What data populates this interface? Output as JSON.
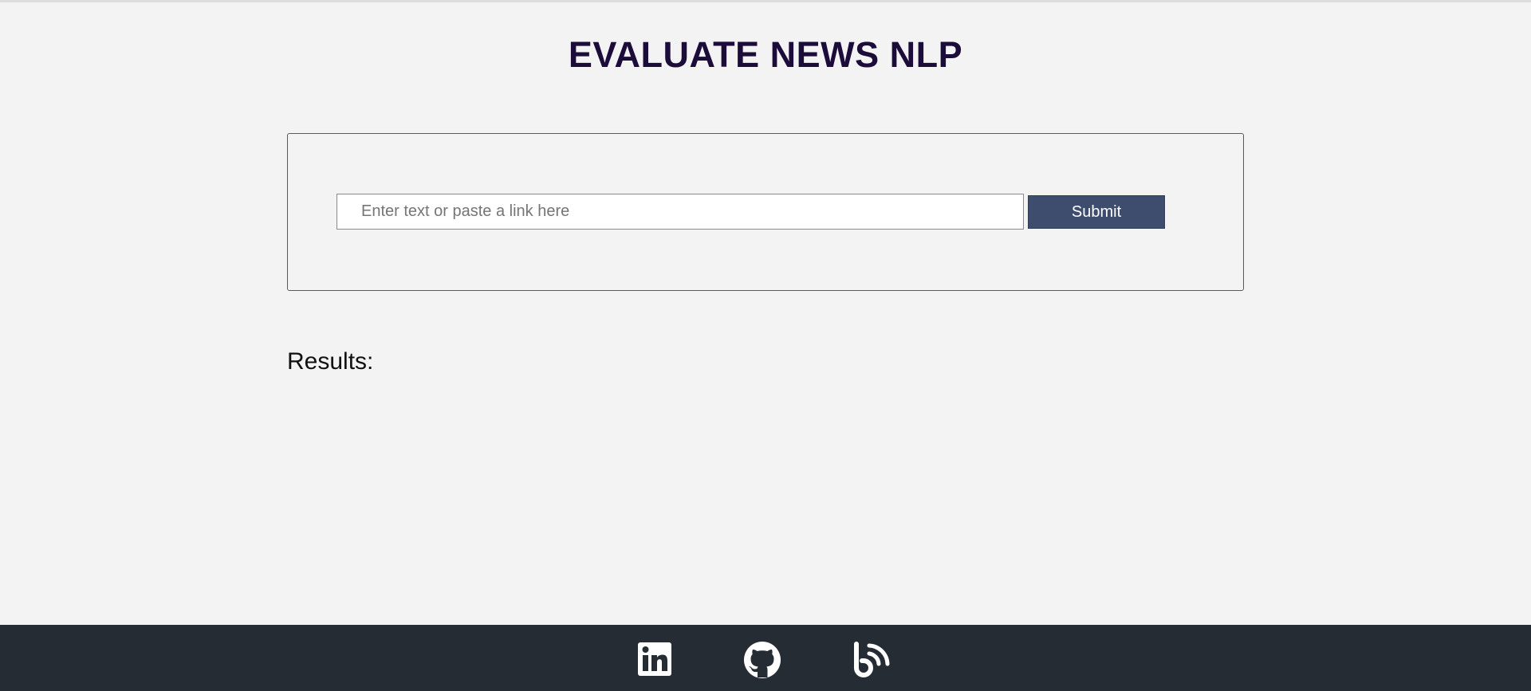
{
  "header": {
    "title": "EVALUATE NEWS NLP"
  },
  "form": {
    "input_placeholder": "Enter text or paste a link here",
    "input_value": "",
    "submit_label": "Submit"
  },
  "results": {
    "heading": "Results:"
  },
  "footer": {
    "links": [
      {
        "icon": "linkedin-icon"
      },
      {
        "icon": "github-icon"
      },
      {
        "icon": "blog-feed-icon"
      }
    ]
  },
  "colors": {
    "background": "#f3f3f3",
    "title": "#1b0c3a",
    "button": "#3e4d6e",
    "footer": "#262c34"
  }
}
